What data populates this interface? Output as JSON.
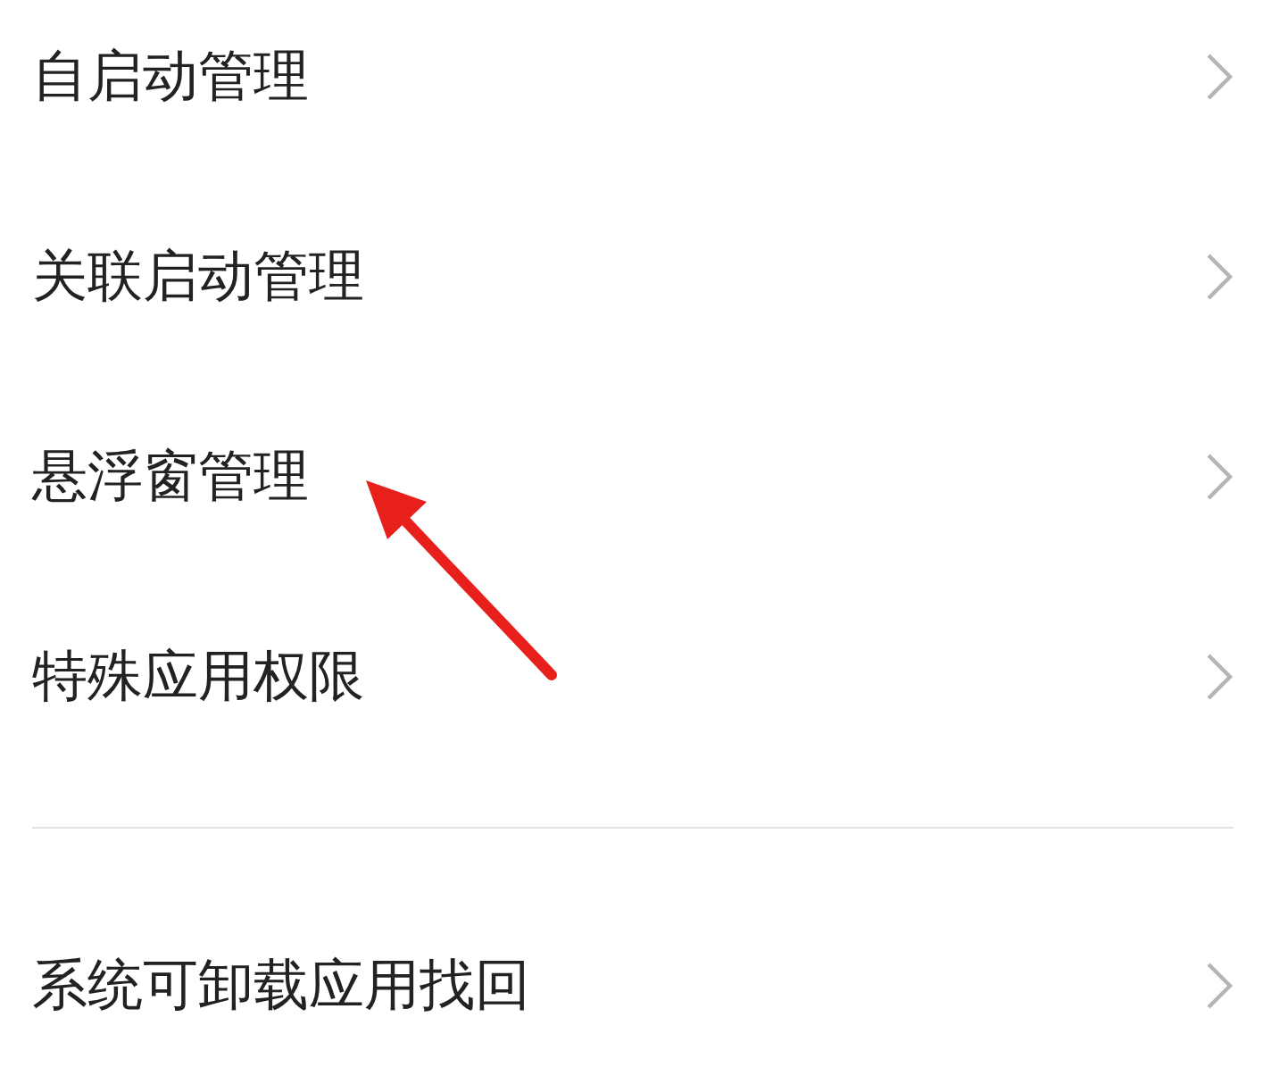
{
  "sections": [
    {
      "items": [
        {
          "label": "自启动管理"
        },
        {
          "label": "关联启动管理"
        },
        {
          "label": "悬浮窗管理"
        },
        {
          "label": "特殊应用权限"
        }
      ]
    },
    {
      "items": [
        {
          "label": "系统可卸载应用找回"
        }
      ]
    }
  ]
}
